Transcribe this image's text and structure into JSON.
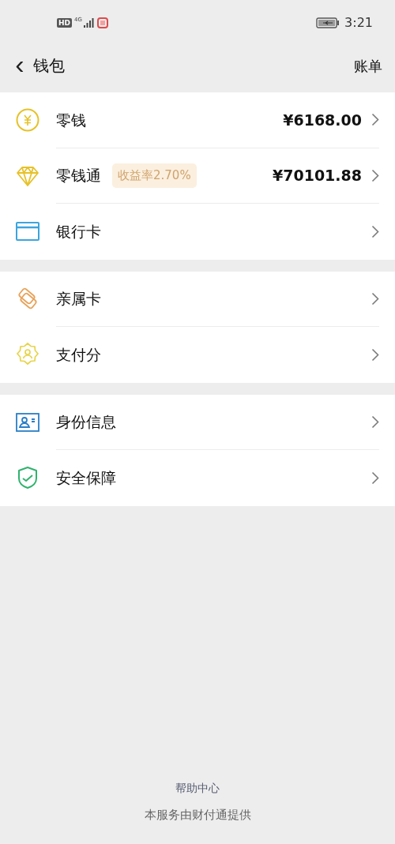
{
  "status_bar": {
    "hd": "HD",
    "network": "4G",
    "time": "3:21"
  },
  "header": {
    "back": "‹",
    "title": "钱包",
    "action": "账单"
  },
  "sections": [
    {
      "items": [
        {
          "kind": "coin",
          "label": "零钱",
          "amount": "¥6168.00"
        },
        {
          "kind": "diamond",
          "label": "零钱通",
          "tag": "收益率2.70%",
          "amount": "¥70101.88"
        },
        {
          "kind": "card",
          "label": "银行卡"
        }
      ]
    },
    {
      "items": [
        {
          "kind": "family",
          "label": "亲属卡"
        },
        {
          "kind": "score",
          "label": "支付分"
        }
      ]
    },
    {
      "items": [
        {
          "kind": "id",
          "label": "身份信息"
        },
        {
          "kind": "shield",
          "label": "安全保障"
        }
      ]
    }
  ],
  "footer": {
    "link": "帮助中心",
    "note": "本服务由财付通提供"
  }
}
